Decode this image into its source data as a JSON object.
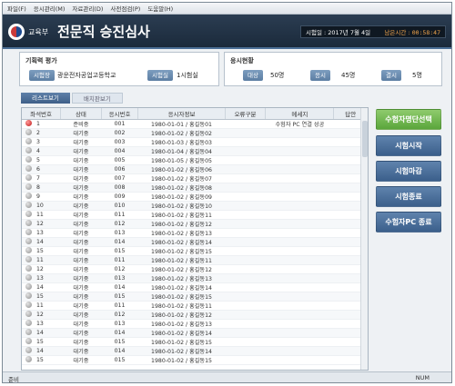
{
  "menu": [
    "파일(F)",
    "응시관리(M)",
    "자료관리(D)",
    "사전점검(P)",
    "도움말(H)"
  ],
  "header": {
    "ministry": "교육부",
    "title": "전문직 승진심사",
    "exam_date_label": "시험일 : 2017년 7월 4일",
    "remain_label": "남은시간 :",
    "remain_value": "00:58:47"
  },
  "exam_panel": {
    "title": "기획력 평가",
    "venue_chip": "시험장",
    "venue_value": "광운전자공업고등학교",
    "room_chip": "시험실",
    "room_value": "1시험실"
  },
  "status_panel": {
    "title": "응시현황",
    "target_chip": "대상",
    "target_value": "50명",
    "present_chip": "응시",
    "present_value": "45명",
    "absent_chip": "결시",
    "absent_value": "5명"
  },
  "tabs": [
    "리스트보기",
    "배치판보기"
  ],
  "table": {
    "columns": [
      "좌석번호",
      "상태",
      "응시번호",
      "응시자정보",
      "오류구분",
      "메세지",
      "답안"
    ],
    "rows": [
      {
        "seat": "1",
        "status": "준비중",
        "num": "001",
        "info": "1980-01-01 / 홍길동01",
        "error": "",
        "msg": "수험자 PC 연결 성공",
        "answer": "",
        "active": true
      },
      {
        "seat": "2",
        "status": "대기중",
        "num": "002",
        "info": "1980-01-02 / 홍길동02",
        "error": "",
        "msg": "",
        "answer": ""
      },
      {
        "seat": "3",
        "status": "대기중",
        "num": "003",
        "info": "1980-01-03 / 홍길동03",
        "error": "",
        "msg": "",
        "answer": ""
      },
      {
        "seat": "4",
        "status": "대기중",
        "num": "004",
        "info": "1980-01-04 / 홍길동04",
        "error": "",
        "msg": "",
        "answer": ""
      },
      {
        "seat": "5",
        "status": "대기중",
        "num": "005",
        "info": "1980-01-05 / 홍길동05",
        "error": "",
        "msg": "",
        "answer": ""
      },
      {
        "seat": "6",
        "status": "대기중",
        "num": "006",
        "info": "1980-01-02 / 홍길동06",
        "error": "",
        "msg": "",
        "answer": ""
      },
      {
        "seat": "7",
        "status": "대기중",
        "num": "007",
        "info": "1980-01-02 / 홍길동07",
        "error": "",
        "msg": "",
        "answer": ""
      },
      {
        "seat": "8",
        "status": "대기중",
        "num": "008",
        "info": "1980-01-02 / 홍길동08",
        "error": "",
        "msg": "",
        "answer": ""
      },
      {
        "seat": "9",
        "status": "대기중",
        "num": "009",
        "info": "1980-01-02 / 홍길동09",
        "error": "",
        "msg": "",
        "answer": ""
      },
      {
        "seat": "10",
        "status": "대기중",
        "num": "010",
        "info": "1980-01-02 / 홍길동10",
        "error": "",
        "msg": "",
        "answer": ""
      },
      {
        "seat": "11",
        "status": "대기중",
        "num": "011",
        "info": "1980-01-02 / 홍길동11",
        "error": "",
        "msg": "",
        "answer": ""
      },
      {
        "seat": "12",
        "status": "대기중",
        "num": "012",
        "info": "1980-01-02 / 홍길동12",
        "error": "",
        "msg": "",
        "answer": ""
      },
      {
        "seat": "13",
        "status": "대기중",
        "num": "013",
        "info": "1980-01-02 / 홍길동13",
        "error": "",
        "msg": "",
        "answer": ""
      },
      {
        "seat": "14",
        "status": "대기중",
        "num": "014",
        "info": "1980-01-02 / 홍길동14",
        "error": "",
        "msg": "",
        "answer": ""
      },
      {
        "seat": "15",
        "status": "대기중",
        "num": "015",
        "info": "1980-01-02 / 홍길동15",
        "error": "",
        "msg": "",
        "answer": ""
      },
      {
        "seat": "11",
        "status": "대기중",
        "num": "011",
        "info": "1980-01-02 / 홍길동11",
        "error": "",
        "msg": "",
        "answer": ""
      },
      {
        "seat": "12",
        "status": "대기중",
        "num": "012",
        "info": "1980-01-02 / 홍길동12",
        "error": "",
        "msg": "",
        "answer": ""
      },
      {
        "seat": "13",
        "status": "대기중",
        "num": "013",
        "info": "1980-01-02 / 홍길동13",
        "error": "",
        "msg": "",
        "answer": ""
      },
      {
        "seat": "14",
        "status": "대기중",
        "num": "014",
        "info": "1980-01-02 / 홍길동14",
        "error": "",
        "msg": "",
        "answer": ""
      },
      {
        "seat": "15",
        "status": "대기중",
        "num": "015",
        "info": "1980-01-02 / 홍길동15",
        "error": "",
        "msg": "",
        "answer": ""
      },
      {
        "seat": "11",
        "status": "대기중",
        "num": "011",
        "info": "1980-01-02 / 홍길동11",
        "error": "",
        "msg": "",
        "answer": ""
      },
      {
        "seat": "12",
        "status": "대기중",
        "num": "012",
        "info": "1980-01-02 / 홍길동12",
        "error": "",
        "msg": "",
        "answer": ""
      },
      {
        "seat": "13",
        "status": "대기중",
        "num": "013",
        "info": "1980-01-02 / 홍길동13",
        "error": "",
        "msg": "",
        "answer": ""
      },
      {
        "seat": "14",
        "status": "대기중",
        "num": "014",
        "info": "1980-01-02 / 홍길동14",
        "error": "",
        "msg": "",
        "answer": ""
      },
      {
        "seat": "15",
        "status": "대기중",
        "num": "015",
        "info": "1980-01-02 / 홍길동15",
        "error": "",
        "msg": "",
        "answer": ""
      },
      {
        "seat": "14",
        "status": "대기중",
        "num": "014",
        "info": "1980-01-02 / 홍길동14",
        "error": "",
        "msg": "",
        "answer": ""
      },
      {
        "seat": "15",
        "status": "대기중",
        "num": "015",
        "info": "1980-01-02 / 홍길동15",
        "error": "",
        "msg": "",
        "answer": ""
      }
    ]
  },
  "buttons": {
    "select": "수험자명단선택",
    "start": "시험시작",
    "close": "시험마감",
    "end": "시험종료",
    "shutdown": "수험자PC 종료"
  },
  "statusbar": {
    "left": "준비",
    "right": "NUM"
  },
  "colors": {
    "header_bg": "#1f2e40",
    "accent_blue": "#4b6f96",
    "green_button": "#6fb54a",
    "active_dot": "#d42a2a"
  }
}
